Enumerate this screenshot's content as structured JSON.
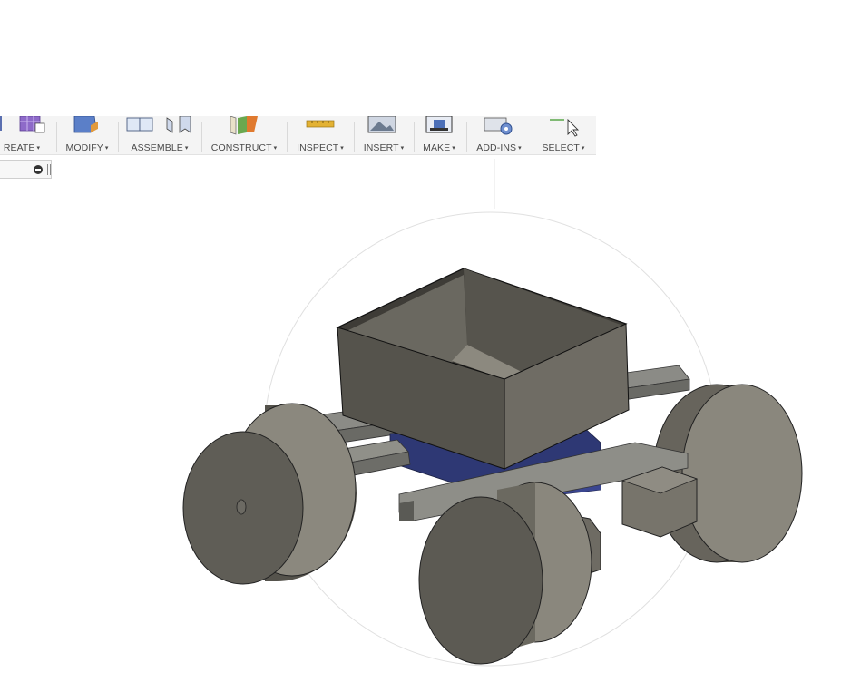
{
  "toolbar": {
    "groups": [
      {
        "id": "create",
        "label": "REATE"
      },
      {
        "id": "modify",
        "label": "MODIFY"
      },
      {
        "id": "assemble",
        "label": "ASSEMBLE"
      },
      {
        "id": "construct",
        "label": "CONSTRUCT"
      },
      {
        "id": "inspect",
        "label": "INSPECT"
      },
      {
        "id": "insert",
        "label": "INSERT"
      },
      {
        "id": "make",
        "label": "MAKE"
      },
      {
        "id": "add_ins",
        "label": "ADD-INS"
      },
      {
        "id": "select",
        "label": "SELECT"
      }
    ],
    "caret": "▾"
  },
  "colors": {
    "toolbar_bg": "#f4f4f4",
    "model_gray": "#6e6b62",
    "model_dark": "#4f4d47",
    "blue_part": "#2f3a73",
    "orbit_circle": "#dcdcdc"
  }
}
